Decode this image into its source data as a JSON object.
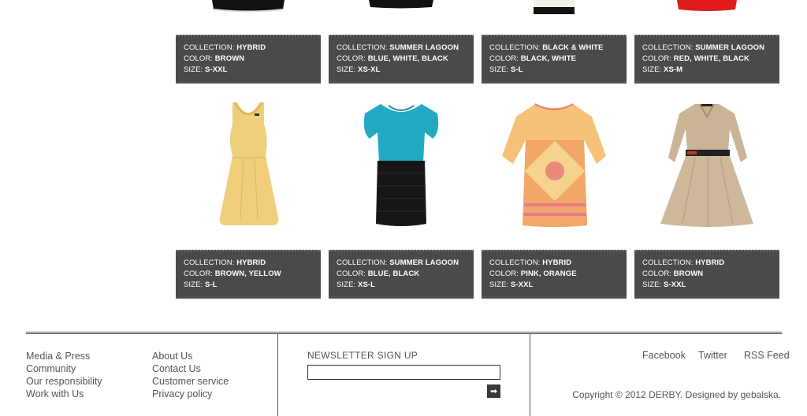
{
  "products_row1": [
    {
      "collection_key": "COLLECTION:",
      "collection": "HYBRID",
      "color_key": "COLOR:",
      "color": "BROWN",
      "size_key": "SIZE:",
      "size": "S-XXL",
      "icon": "black-dress-image"
    },
    {
      "collection_key": "COLLECTION:",
      "collection": "SUMMER LAGOON",
      "color_key": "COLOR:",
      "color": "BLUE, WHITE, BLACK",
      "size_key": "SIZE:",
      "size": "XS-XL",
      "icon": "black-dress-image"
    },
    {
      "collection_key": "COLLECTION:",
      "collection": "BLACK & WHITE",
      "color_key": "COLOR:",
      "color": "BLACK, WHITE",
      "size_key": "SIZE:",
      "size": "S-L",
      "icon": "white-black-dress-image"
    },
    {
      "collection_key": "COLLECTION:",
      "collection": "SUMMER LAGOON",
      "color_key": "COLOR:",
      "color": "RED, WHITE, BLACK",
      "size_key": "SIZE:",
      "size": "XS-M",
      "icon": "red-dress-image"
    }
  ],
  "products_row2": [
    {
      "collection_key": "COLLECTION:",
      "collection": "HYBRID",
      "color_key": "COLOR:",
      "color": "BROWN, YELLOW",
      "size_key": "SIZE:",
      "size": "S-L",
      "icon": "yellow-dress-image"
    },
    {
      "collection_key": "COLLECTION:",
      "collection": "SUMMER LAGOON",
      "color_key": "COLOR:",
      "color": "BLUE, BLACK",
      "size_key": "SIZE:",
      "size": "XS-L",
      "icon": "blue-black-dress-image"
    },
    {
      "collection_key": "COLLECTION:",
      "collection": "HYBRID",
      "color_key": "COLOR:",
      "color": "PINK, ORANGE",
      "size_key": "SIZE:",
      "size": "S-XXL",
      "icon": "pink-orange-dress-image"
    },
    {
      "collection_key": "COLLECTION:",
      "collection": "HYBRID",
      "color_key": "COLOR:",
      "color": "BROWN",
      "size_key": "SIZE:",
      "size": "S-XXL",
      "icon": "beige-belted-dress-image"
    }
  ],
  "footer": {
    "col1": [
      "Media & Press",
      "Community",
      "Our responsibility",
      "Work with Us"
    ],
    "col2": [
      "About Us",
      "Contact Us",
      "Customer service",
      "Privacy policy"
    ],
    "newsletter_title": "NEWSLETTER SIGN UP",
    "newsletter_placeholder": "",
    "submit_icon": "arrow-right-icon",
    "social": [
      "Facebook",
      "Twitter",
      "RSS Feed"
    ],
    "copyright": "Copyright © 2012 DERBY. Designed by gebalska."
  },
  "colors": {
    "info_bg": "#4a4a4a",
    "text": "#555555"
  }
}
